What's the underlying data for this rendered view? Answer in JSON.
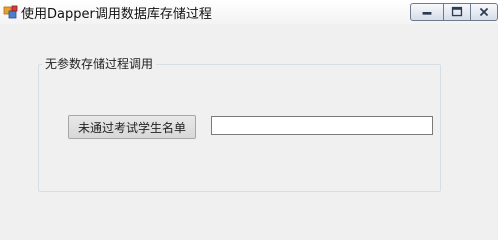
{
  "window": {
    "title": "使用Dapper调用数据库存储过程",
    "app_icon": "winforms-app-icon",
    "controls": {
      "minimize_icon": "minimize-icon",
      "maximize_icon": "maximize-icon",
      "close_icon": "close-icon"
    }
  },
  "group": {
    "legend": "无参数存储过程调用"
  },
  "form": {
    "button_label": "未通过考试学生名单",
    "result_value": "",
    "result_placeholder": ""
  }
}
